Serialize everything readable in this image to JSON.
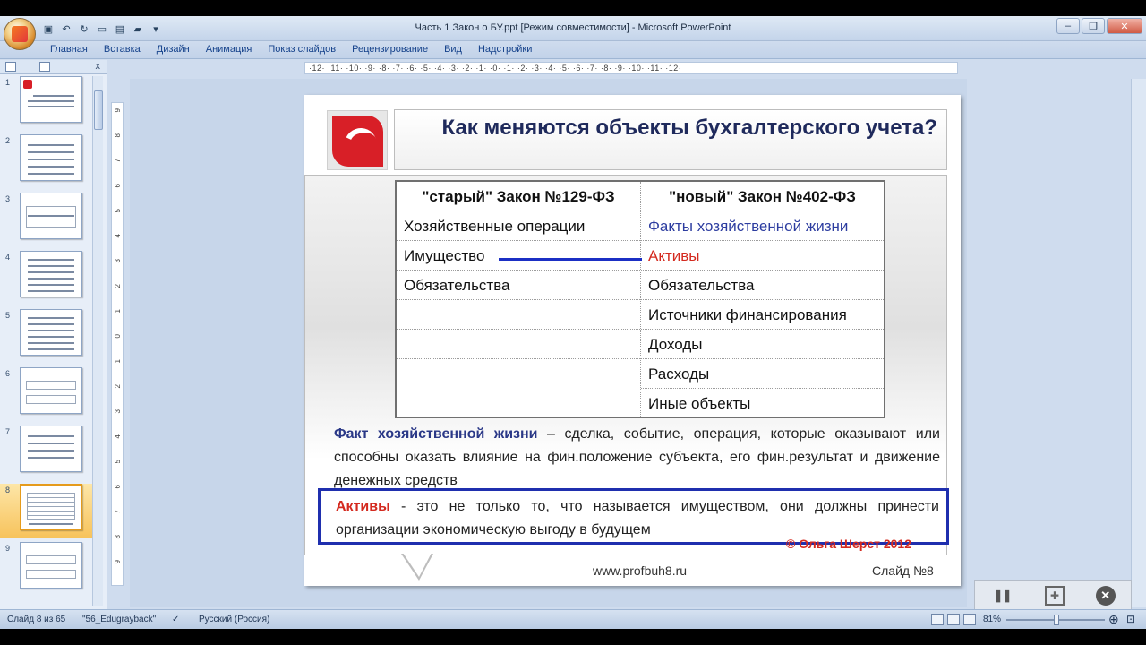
{
  "window": {
    "title": "Часть 1 Закон о БУ.ppt [Режим совместимости] - Microsoft PowerPoint",
    "minimize": "–",
    "restore": "❐",
    "close": "✕"
  },
  "ribbon": {
    "tabs": [
      "Главная",
      "Вставка",
      "Дизайн",
      "Анимация",
      "Показ слайдов",
      "Рецензирование",
      "Вид",
      "Надстройки"
    ]
  },
  "slide_panel": {
    "close": "x",
    "numbers": [
      "1",
      "2",
      "3",
      "4",
      "5",
      "6",
      "7",
      "8",
      "9"
    ],
    "selected_slide": 8
  },
  "ruler": {
    "horizontal": "·12· ·11· ·10· ·9· ·8· ·7· ·6· ·5· ·4· ·3· ·2· ·1· ·0· ·1· ·2· ·3· ·4· ·5· ·6· ·7· ·8· ·9· ·10· ·11· ·12·",
    "vertical": [
      "9",
      "8",
      "7",
      "6",
      "5",
      "4",
      "3",
      "2",
      "1",
      "0",
      "1",
      "2",
      "3",
      "4",
      "5",
      "6",
      "7",
      "8",
      "9"
    ]
  },
  "slide": {
    "title": "Как меняются объекты бухгалтерского учета?",
    "table": {
      "header_left": "\"старый\" Закон №129-ФЗ",
      "header_right": "\"новый\" Закон №402-ФЗ",
      "left_rows": [
        "Хозяйственные операции",
        "Имущество",
        "Обязательства",
        "",
        "",
        ""
      ],
      "right_rows": [
        "Факты хозяйственной жизни",
        "Активы",
        "Обязательства",
        "Источники финансирования",
        "Доходы",
        "Расходы",
        "Иные объекты"
      ]
    },
    "fact_term": "Факт хозяйственной жизни",
    "fact_text": " –   сделка, событие, операция, которые оказывают или способны оказать влияние на фин.положение субъекта, его фин.результат и движение денежных средств",
    "assets_term": "Активы",
    "assets_text": "  - это не только то, что называется имуществом, они должны принести организации экономическую выгоду в будущем",
    "copyright": "© Ольга Шерст  2012",
    "site": "www.profbuh8.ru",
    "slide_label": "Слайд №8"
  },
  "status": {
    "slide_of": "Слайд 8 из 65",
    "theme": "\"56_Edugrayback\"",
    "language": "Русский (Россия)",
    "zoom": "81%"
  },
  "colors": {
    "accent_red": "#d81f27",
    "title_blue": "#1f2a5c",
    "term_blue": "#2a3887",
    "box_blue": "#1f2fae"
  }
}
